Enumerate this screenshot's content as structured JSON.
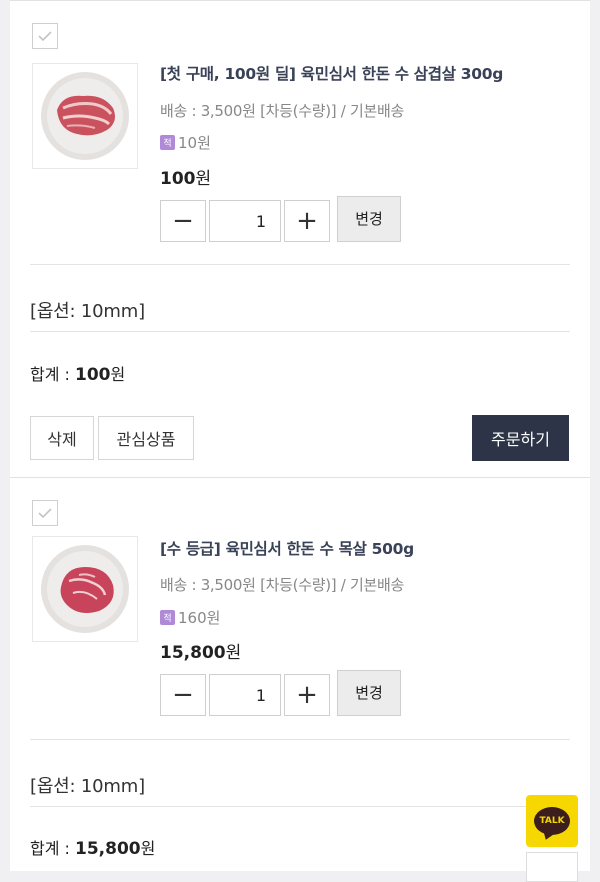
{
  "items": [
    {
      "title": "[첫 구매, 100원 딜] 육민심서 한돈 수 삼겹살 300g",
      "shipping": "배송 : 3,500원 [차등(수량)] / 기본배송",
      "point_badge": "적",
      "points": "10원",
      "price_num": "100",
      "price_unit": "원",
      "quantity": "1",
      "change_label": "변경",
      "option": "[옵션: 10mm]",
      "total_label": "합계 : ",
      "total_num": "100",
      "total_unit": "원",
      "delete_label": "삭제",
      "wishlist_label": "관심상품",
      "order_label": "주문하기",
      "thumb_icon": "pork-belly-on-plate"
    },
    {
      "title": "[수 등급] 육민심서 한돈 수 목살 500g",
      "shipping": "배송 : 3,500원 [차등(수량)] / 기본배송",
      "point_badge": "적",
      "points": "160원",
      "price_num": "15,800",
      "price_unit": "원",
      "quantity": "1",
      "change_label": "변경",
      "option": "[옵션: 10mm]",
      "total_label": "합계 : ",
      "total_num": "15,800",
      "total_unit": "원",
      "thumb_icon": "pork-neck-on-plate"
    }
  ],
  "kakao": {
    "label": "TALK"
  },
  "icons": {
    "minus": "−",
    "plus": "+"
  },
  "colors": {
    "order_button": "#2d3447",
    "title": "#3a4257",
    "kakao": "#f6d800",
    "point_badge": "#b08ad6"
  }
}
